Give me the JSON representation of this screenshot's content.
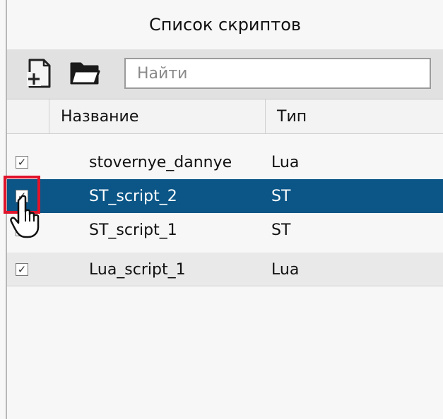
{
  "panel": {
    "title": "Список скриптов"
  },
  "toolbar": {
    "add_icon": "add-file-icon",
    "open_icon": "folder-open-icon",
    "search_placeholder": "Найти"
  },
  "table": {
    "columns": [
      "Название",
      "Тип"
    ],
    "rows": [
      {
        "checked": true,
        "name": "stovernye_dannye",
        "type": "Lua",
        "selected": false
      },
      {
        "checked": true,
        "name": "ST_script_2",
        "type": "ST",
        "selected": true
      },
      {
        "checked": true,
        "name": "ST_script_1",
        "type": "ST",
        "selected": false
      },
      {
        "checked": true,
        "name": "Lua_script_1",
        "type": "Lua",
        "selected": false
      }
    ]
  },
  "colors": {
    "selection": "#0b5687",
    "highlight": "#e0142b"
  },
  "cursor_icon": "hand-pointer-icon"
}
